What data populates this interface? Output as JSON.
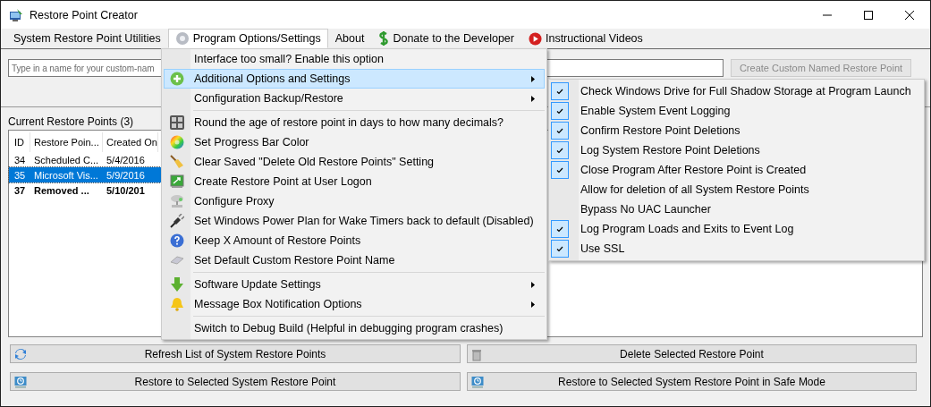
{
  "window": {
    "title": "Restore Point Creator"
  },
  "menu_bar": [
    {
      "label": "System Restore Point Utilities",
      "selected": false
    },
    {
      "label": "Program Options/Settings",
      "selected": true
    },
    {
      "label": "About",
      "selected": false
    },
    {
      "label": "Donate to the Developer",
      "selected": false
    },
    {
      "label": "Instructional Videos",
      "selected": false
    }
  ],
  "name_field": {
    "placeholder": "Type in a name for your custom-nam"
  },
  "create_button": {
    "label": "Create Custom Named Restore Point",
    "disabled": true
  },
  "list_title": "Current Restore Points (3)",
  "table": {
    "columns": [
      "ID",
      "Restore Poin...",
      "Created On"
    ],
    "rows": [
      {
        "cells": [
          "34",
          "Scheduled C...",
          "5/4/2016"
        ],
        "selected": false,
        "bold": false
      },
      {
        "cells": [
          "35",
          "Microsoft Vis...",
          "5/9/2016"
        ],
        "selected": true,
        "bold": false
      },
      {
        "cells": [
          "37",
          "Removed ...",
          "5/10/201"
        ],
        "selected": false,
        "bold": true
      }
    ]
  },
  "buttons": [
    {
      "label": "Refresh List of System Restore Points"
    },
    {
      "label": "Delete Selected Restore Point"
    },
    {
      "label": "Restore to Selected System Restore Point"
    },
    {
      "label": "Restore to Selected System Restore Point in Safe Mode"
    }
  ],
  "options_menu": {
    "groups": [
      [
        {
          "label": "Interface too small? Enable this option",
          "selected": false,
          "submenu": false
        },
        {
          "label": "Additional Options and Settings",
          "selected": true,
          "submenu": true
        },
        {
          "label": "Configuration Backup/Restore",
          "selected": false,
          "submenu": true
        }
      ],
      [
        {
          "label": "Round the age of restore point in days to how many decimals?",
          "selected": false,
          "submenu": false
        },
        {
          "label": "Set Progress Bar Color",
          "selected": false,
          "submenu": false
        },
        {
          "label": "Clear Saved \"Delete Old Restore Points\" Setting",
          "selected": false,
          "submenu": false
        },
        {
          "label": "Create Restore Point at User Logon",
          "selected": false,
          "submenu": false
        },
        {
          "label": "Configure Proxy",
          "selected": false,
          "submenu": false
        },
        {
          "label": "Set Windows Power Plan for Wake Timers back to default (Disabled)",
          "selected": false,
          "submenu": false
        },
        {
          "label": "Keep X Amount of Restore Points",
          "selected": false,
          "submenu": false
        },
        {
          "label": "Set Default Custom Restore Point Name",
          "selected": false,
          "submenu": false
        }
      ],
      [
        {
          "label": "Software Update Settings",
          "selected": false,
          "submenu": true
        },
        {
          "label": "Message Box Notification Options",
          "selected": false,
          "submenu": true
        }
      ],
      [
        {
          "label": "Switch to Debug Build (Helpful in debugging program crashes)",
          "selected": false,
          "submenu": false
        }
      ]
    ]
  },
  "additional_submenu": [
    {
      "label": "Check Windows Drive for Full Shadow Storage at Program Launch",
      "checked": true
    },
    {
      "label": "Enable System Event Logging",
      "checked": true
    },
    {
      "label": "Confirm Restore Point Deletions",
      "checked": true
    },
    {
      "label": "Log System Restore Point Deletions",
      "checked": true
    },
    {
      "label": "Close Program After Restore Point is Created",
      "checked": true
    },
    {
      "label": "Allow for deletion of all System Restore Points",
      "checked": false
    },
    {
      "label": "Bypass No UAC Launcher",
      "checked": false
    },
    {
      "label": "Log Program Loads and Exits to Event Log",
      "checked": true
    },
    {
      "label": "Use SSL",
      "checked": true
    }
  ]
}
